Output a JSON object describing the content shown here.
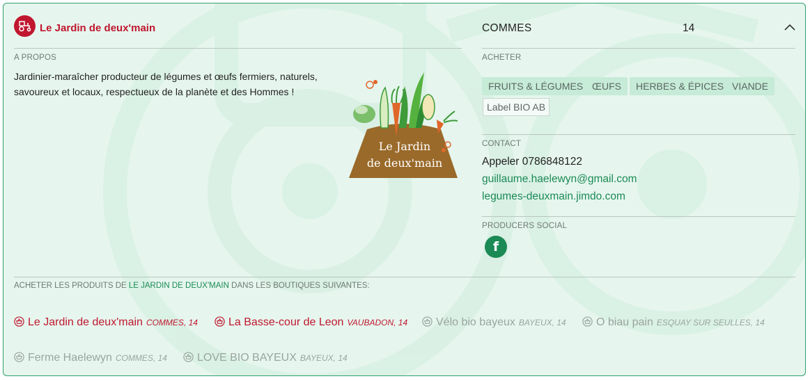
{
  "producer": {
    "name": "Le Jardin de deux'main",
    "icon": "tractor-icon"
  },
  "about": {
    "label": "A PROPOS",
    "text": "Jardinier-maraîcher producteur de légumes et œufs fermiers, naturels, savoureux et locaux, respectueux de la planète et des Hommes !"
  },
  "logo": {
    "line1": "Le Jardin",
    "line2": "de deux'main"
  },
  "location": {
    "city": "COMMES",
    "department": "14"
  },
  "buy": {
    "label": "ACHETER",
    "categories": [
      "FRUITS & LÉGUMES",
      "ŒUFS",
      "HERBES & ÉPICES",
      "VIANDE"
    ],
    "labels": [
      "Label BIO AB"
    ]
  },
  "contact": {
    "label": "CONTACT",
    "phone": "Appeler 0786848122",
    "email": "guillaume.haelewyn@gmail.com",
    "website": "legumes-deuxmain.jimdo.com"
  },
  "social": {
    "label": "PRODUCERS SOCIAL",
    "facebook_glyph": "f"
  },
  "shops": {
    "label_before": "ACHETER LES PRODUITS DE",
    "label_highlight": "LE JARDIN DE DEUX'MAIN",
    "label_after": "DANS LES BOUTIQUES SUIVANTES:",
    "items": [
      {
        "name": "Le Jardin de deux'main",
        "location": "COMMES, 14",
        "active": true
      },
      {
        "name": "La Basse-cour de Leon",
        "location": "VAUBADON, 14",
        "active": true
      },
      {
        "name": "Vélo bio bayeux",
        "location": "BAYEUX, 14",
        "active": false
      },
      {
        "name": "O biau pain",
        "location": "ESQUAY SUR SEULLES, 14",
        "active": false
      },
      {
        "name": "Ferme Haelewyn",
        "location": "COMMES, 14",
        "active": false
      },
      {
        "name": "LOVE BIO BAYEUX",
        "location": "BAYEUX, 14",
        "active": false
      }
    ]
  },
  "colors": {
    "brand_red": "#c0172f",
    "accent_green": "#1b8a55",
    "card_bg": "#e6f6ee",
    "tag_bg": "#c6ebd7"
  }
}
